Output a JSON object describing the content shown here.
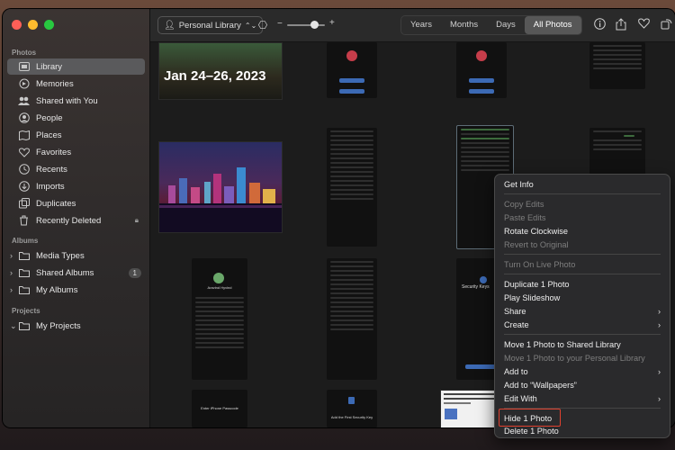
{
  "sidebar": {
    "photos_header": "Photos",
    "items": [
      {
        "label": "Library"
      },
      {
        "label": "Memories"
      },
      {
        "label": "Shared with You"
      },
      {
        "label": "People"
      },
      {
        "label": "Places"
      },
      {
        "label": "Favorites"
      },
      {
        "label": "Recents"
      },
      {
        "label": "Imports"
      },
      {
        "label": "Duplicates"
      },
      {
        "label": "Recently Deleted"
      }
    ],
    "albums_header": "Albums",
    "albums": [
      {
        "label": "Media Types"
      },
      {
        "label": "Shared Albums",
        "badge": "1"
      },
      {
        "label": "My Albums"
      }
    ],
    "projects_header": "Projects",
    "projects": [
      {
        "label": "My Projects"
      }
    ]
  },
  "toolbar": {
    "library_selector": "Personal Library",
    "zoom_minus": "−",
    "zoom_plus": "+",
    "tabs": [
      "Years",
      "Months",
      "Days",
      "All Photos"
    ],
    "active_tab": "All Photos"
  },
  "grid": {
    "date_header": "Jan 24–26, 2023",
    "thumb_text_passcode": "Enter iPhone Passcode",
    "thumb_text_security": "Add the First Security Key",
    "thumb_text_security_keys": "Security Keys",
    "thumb_text_profile_name": "Aravind Hyvind"
  },
  "context_menu": {
    "items": [
      {
        "label": "Get Info",
        "enabled": true
      },
      {
        "label": "Copy Edits",
        "enabled": false
      },
      {
        "label": "Paste Edits",
        "enabled": false
      },
      {
        "label": "Rotate Clockwise",
        "enabled": true
      },
      {
        "label": "Revert to Original",
        "enabled": false
      },
      {
        "label": "Turn On Live Photo",
        "enabled": false
      },
      {
        "label": "Duplicate 1 Photo",
        "enabled": true
      },
      {
        "label": "Play Slideshow",
        "enabled": true
      },
      {
        "label": "Share",
        "enabled": true,
        "submenu": true
      },
      {
        "label": "Create",
        "enabled": true,
        "submenu": true
      },
      {
        "label": "Move 1 Photo to Shared Library",
        "enabled": true
      },
      {
        "label": "Move 1 Photo to your Personal Library",
        "enabled": false
      },
      {
        "label": "Add to",
        "enabled": true,
        "submenu": true
      },
      {
        "label": "Add to “Wallpapers”",
        "enabled": true
      },
      {
        "label": "Edit With",
        "enabled": true,
        "submenu": true
      },
      {
        "label": "Hide 1 Photo",
        "enabled": true,
        "highlighted": true
      },
      {
        "label": "Delete 1 Photo",
        "enabled": true
      }
    ]
  },
  "colors": {
    "close": "#ff5f57",
    "minimize": "#febc2e",
    "zoom": "#28c840",
    "highlight_box": "#e0412f"
  }
}
